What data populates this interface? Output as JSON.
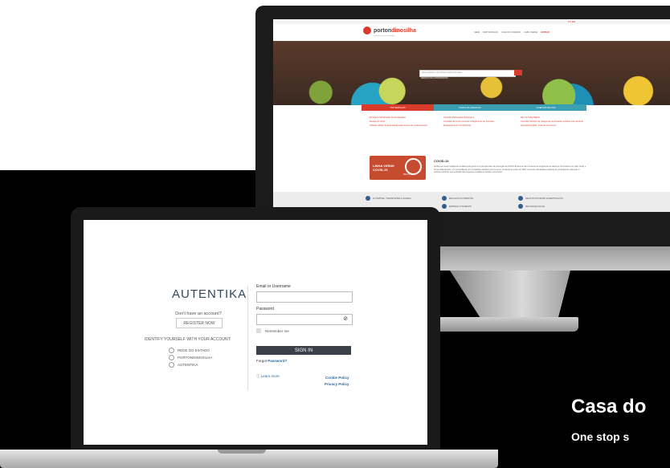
{
  "monitor_site": {
    "lang": "PT  EN",
    "logo_prefix": "porton",
    "logo_accent": "dinosilha",
    "logo_tagline": "Portal de serviços ao cidadão",
    "nav": [
      "SEDE",
      "PARTICIPAÇÃO",
      "CASA DO CIDADÃO",
      "CABO VERDE"
    ],
    "nav_login": "ENTRAR",
    "search_placeholder": "Quero efetuar o meu primeiro reforço de testes...",
    "service_note": "SERVIÇO DE CONTRAPROVA",
    "tabs": [
      "TOP SERVIÇOS",
      "TODOS OS SERVIÇOS",
      "EVENTOS DE VIDA"
    ],
    "links_col1": [
      "Entrega e Substituição de Declarações",
      "Desejar de Ilícito",
      "Solicitar código de autorização para compra de medicamentos"
    ],
    "links_col2": [
      "Consulta Declarações Entregues",
      "Consulta da Conta Corrente e Pagamento de Impostos",
      "Enquadramento Contribuintes"
    ],
    "links_col3": [
      "NIF Consulta Salário",
      "Consulta histórico de códigos de autorização emitidos este território",
      "Secretaria Digital - Lista de Concursos"
    ],
    "covid_badge": "LINHA VERDE COVID-19",
    "covid_phone": "800 11 12",
    "covid_title": "COVID-19",
    "covid_text": "Confira as novas medidas anunciadas pelo governo na primeira fase da prevenção da COVID-19 face ao risco iminente de surgimento de casos de Coronavírus em Cabo Verde e do seu alastramento, em concordância com os Estados afetados pelo Governo, no dia 16 de março de 2020, à Governo declarada a situação de Contingência, para todo o território nacional; com a adoção das seguintes medidas de carácter excecional:",
    "footer_items": [
      "AUTOMÓVEL, TRANSPORTES E VIAGENS",
      "EDUCAÇÃO E FORMAÇÃO",
      "REGISTO NOTARIADO E IDENTIFICAÇÃO",
      "EMPREGO E TRABALHO",
      "SEGURANÇA SOCIAL"
    ]
  },
  "login": {
    "brand": "AUTENTIKA",
    "no_account": "Don't have an account?",
    "register": "REGISTER NOW",
    "identify": "IDENTIFY YOURSELF WITH YOUR ACCOUNT:",
    "providers": [
      "REDE DO ESTADO",
      "PORTONDINOSILHA",
      "AUTENTIKA"
    ],
    "email_label": "Email or Username",
    "password_label": "Password",
    "remember": "Remember me",
    "signin": "SIGN IN",
    "forgot_prefix": "Forgot",
    "forgot_link": "Password?",
    "learn_more": "Learn more",
    "cookie_policy": "Cookie Policy",
    "privacy_policy": "Privacy Policy"
  },
  "caption": {
    "title": "Casa do",
    "subtitle": "One stop s"
  }
}
